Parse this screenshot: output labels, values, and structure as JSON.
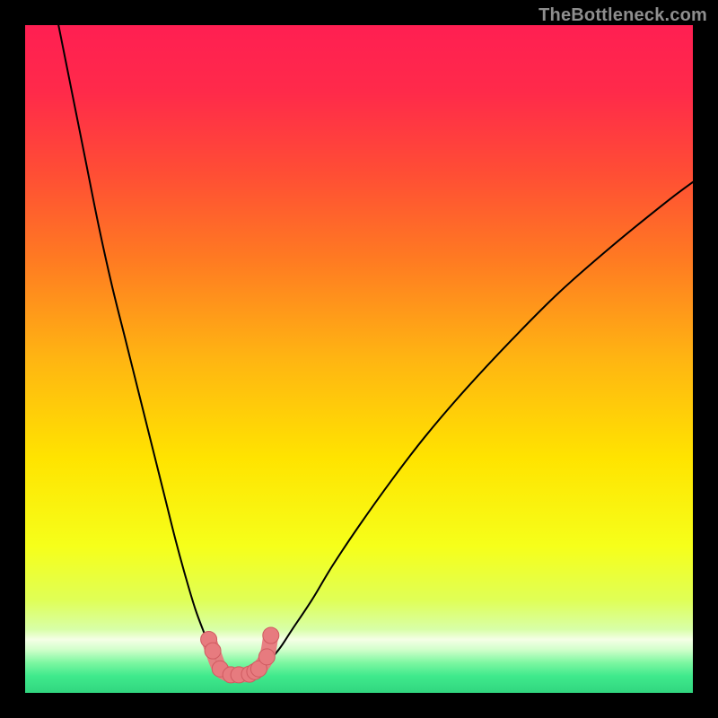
{
  "watermark": "TheBottleneck.com",
  "colors": {
    "frame": "#000000",
    "curve": "#000000",
    "dots": "#e77b7f",
    "dotsStroke": "#cf5a60",
    "gradientStops": [
      {
        "offset": 0.0,
        "color": "#ff1f52"
      },
      {
        "offset": 0.1,
        "color": "#ff2a4a"
      },
      {
        "offset": 0.22,
        "color": "#ff4d35"
      },
      {
        "offset": 0.35,
        "color": "#ff7a22"
      },
      {
        "offset": 0.5,
        "color": "#ffb512"
      },
      {
        "offset": 0.65,
        "color": "#ffe400"
      },
      {
        "offset": 0.78,
        "color": "#f6ff1a"
      },
      {
        "offset": 0.86,
        "color": "#e0ff55"
      },
      {
        "offset": 0.905,
        "color": "#d8ffa8"
      },
      {
        "offset": 0.92,
        "color": "#f5ffe6"
      },
      {
        "offset": 0.935,
        "color": "#d2ffcb"
      },
      {
        "offset": 0.955,
        "color": "#7cf7a1"
      },
      {
        "offset": 0.975,
        "color": "#3fe98c"
      },
      {
        "offset": 1.0,
        "color": "#31d67f"
      }
    ]
  },
  "chart_data": {
    "type": "line",
    "title": "",
    "xlabel": "",
    "ylabel": "",
    "xlim": [
      0,
      100
    ],
    "ylim": [
      0,
      100
    ],
    "series": [
      {
        "name": "bottleneck-curve",
        "x": [
          5,
          7,
          9,
          11,
          13,
          15,
          17,
          19,
          21,
          22.5,
          24,
          25.5,
          27,
          28,
          29,
          30,
          31.5,
          33,
          34.5,
          36,
          38,
          40,
          43,
          46,
          50,
          55,
          60,
          66,
          73,
          80,
          88,
          96,
          100
        ],
        "values": [
          100,
          90,
          80,
          70,
          61,
          53,
          45,
          37,
          29,
          23,
          17.5,
          12.5,
          8.5,
          6,
          4.2,
          3.2,
          2.7,
          2.7,
          3.2,
          4.3,
          6.5,
          9.5,
          14,
          19,
          25,
          32,
          38.5,
          45.5,
          53,
          60,
          67,
          73.5,
          76.5
        ]
      }
    ],
    "points": {
      "name": "highlight-dots",
      "x": [
        27.5,
        28.1,
        29.2,
        30.8,
        32.0,
        33.6,
        34.4,
        35.0,
        36.2,
        36.8
      ],
      "values": [
        8.0,
        6.3,
        3.6,
        2.7,
        2.7,
        2.8,
        3.2,
        3.6,
        5.4,
        8.6
      ]
    }
  }
}
